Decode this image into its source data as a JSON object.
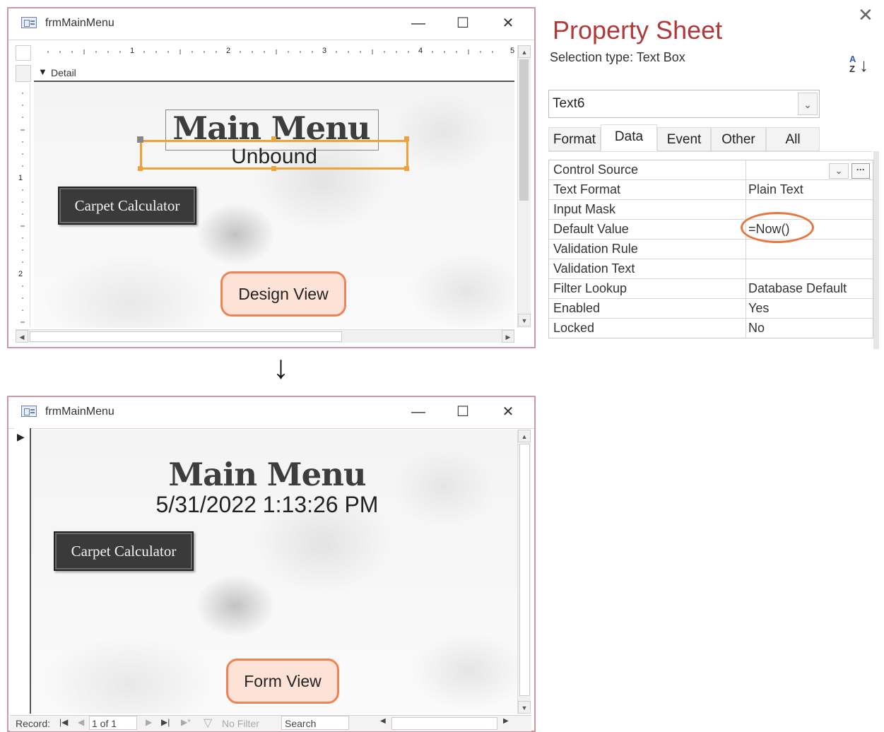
{
  "design_window": {
    "title": "frmMainMenu",
    "section_label": "Detail",
    "ruler_numbers": [
      "1",
      "2",
      "3",
      "4",
      "5"
    ],
    "vruler_numbers": [
      "1",
      "2"
    ],
    "heading": "Main Menu",
    "textbox_value": "Unbound",
    "button_label": "Carpet Calculator",
    "callout": "Design View"
  },
  "arrow_glyph": "↓",
  "form_window": {
    "title": "frmMainMenu",
    "heading": "Main Menu",
    "datetime": "5/31/2022 1:13:26 PM",
    "button_label": "Carpet Calculator",
    "callout": "Form View",
    "record_nav": {
      "label": "Record:",
      "position": "1 of 1",
      "filter": "No Filter",
      "search_placeholder": "Search"
    }
  },
  "property_sheet": {
    "title": "Property Sheet",
    "selection_type": "Selection type:  Text Box",
    "selected_object": "Text6",
    "tabs": [
      "Format",
      "Data",
      "Event",
      "Other",
      "All"
    ],
    "active_tab": "Data",
    "rows": [
      {
        "label": "Control Source",
        "value": ""
      },
      {
        "label": "Text Format",
        "value": "Plain Text"
      },
      {
        "label": "Input Mask",
        "value": ""
      },
      {
        "label": "Default Value",
        "value": "=Now()"
      },
      {
        "label": "Validation Rule",
        "value": ""
      },
      {
        "label": "Validation Text",
        "value": ""
      },
      {
        "label": "Filter Lookup",
        "value": "Database Default"
      },
      {
        "label": "Enabled",
        "value": "Yes"
      },
      {
        "label": "Locked",
        "value": "No"
      }
    ],
    "highlight_color": "#e8773f"
  },
  "colors": {
    "window_border": "#c99aa2",
    "callout_fill": "#fde3d7",
    "callout_border": "#ee8455",
    "selection_orange": "#f0a23a",
    "title_red": "#b03a3a"
  }
}
